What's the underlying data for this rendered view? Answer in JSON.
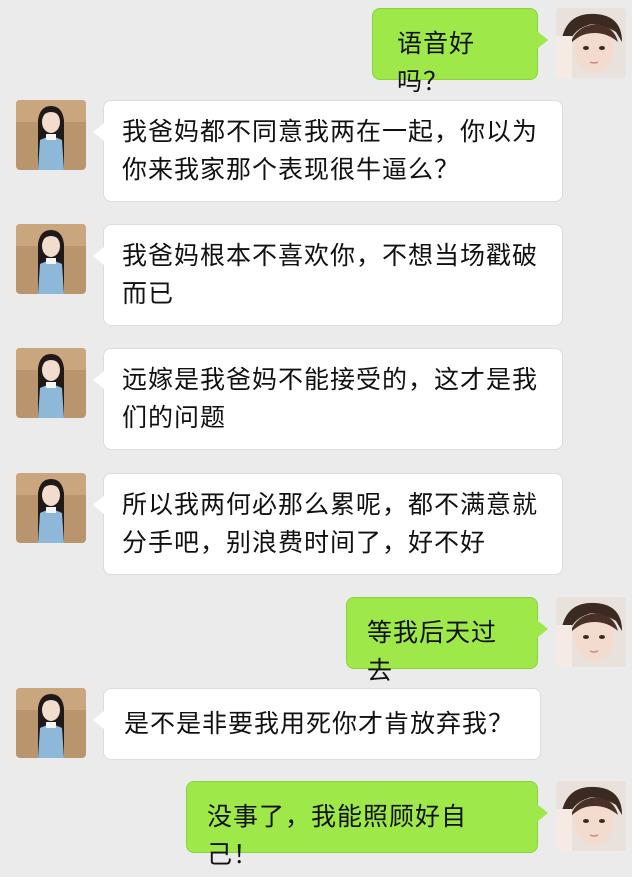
{
  "messages": [
    {
      "side": "right",
      "avatar": "male-avatar-icon",
      "text": "语音好吗？"
    },
    {
      "side": "left",
      "avatar": "female-avatar-icon",
      "text": "我爸妈都不同意我两在一起，你以为你来我家那个表现很牛逼么？"
    },
    {
      "side": "left",
      "avatar": "female-avatar-icon",
      "text": "我爸妈根本不喜欢你，不想当场戳破而已"
    },
    {
      "side": "left",
      "avatar": "female-avatar-icon",
      "text": "远嫁是我爸妈不能接受的，这才是我们的问题"
    },
    {
      "side": "left",
      "avatar": "female-avatar-icon",
      "text": "所以我两何必那么累呢，都不满意就分手吧，别浪费时间了，好不好"
    },
    {
      "side": "right",
      "avatar": "male-avatar-icon",
      "text": "等我后天过去"
    },
    {
      "side": "left",
      "avatar": "female-avatar-icon",
      "text": "是不是非要我用死你才肯放弃我？"
    },
    {
      "side": "right",
      "avatar": "male-avatar-icon",
      "text": "没事了，我能照顾好自己！"
    }
  ],
  "colors": {
    "background": "#ebebeb",
    "sent_bubble": "#9ee84a",
    "received_bubble": "#ffffff"
  }
}
